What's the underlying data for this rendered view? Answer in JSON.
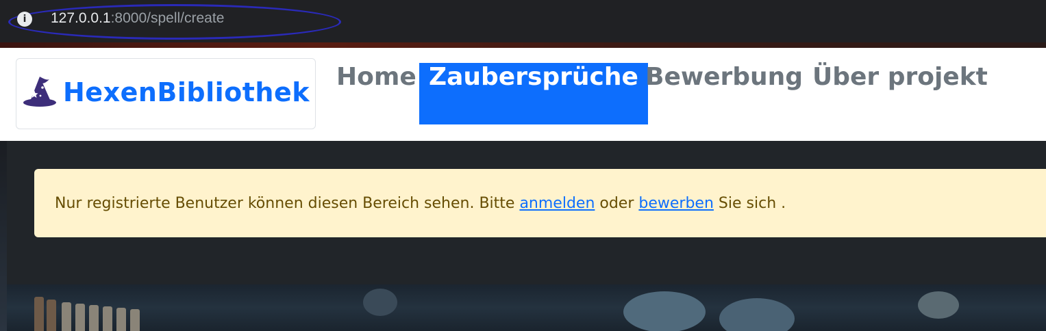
{
  "browser": {
    "url_host": "127.0.0.1",
    "url_rest": ":8000/spell/create",
    "info_icon": "info-icon"
  },
  "navbar": {
    "brand": "HexenBibliothek",
    "brand_icon": "wizard-hat-icon",
    "items": [
      {
        "label": "Home",
        "active": false
      },
      {
        "label": "Zaubersprüche",
        "active": true
      },
      {
        "label": "Bewerbung",
        "active": false
      },
      {
        "label": "Über projekt",
        "active": false
      }
    ]
  },
  "alert": {
    "text_before": "Nur registrierte Benutzer können diesen Bereich sehen. Bitte ",
    "login_link": "anmelden",
    "text_middle": " oder ",
    "apply_link": "bewerben",
    "text_after": " Sie sich ."
  },
  "colors": {
    "primary": "#0d6efd",
    "alert_bg": "#fff3cd",
    "alert_text": "#664d03",
    "dark_bg": "#212529"
  }
}
